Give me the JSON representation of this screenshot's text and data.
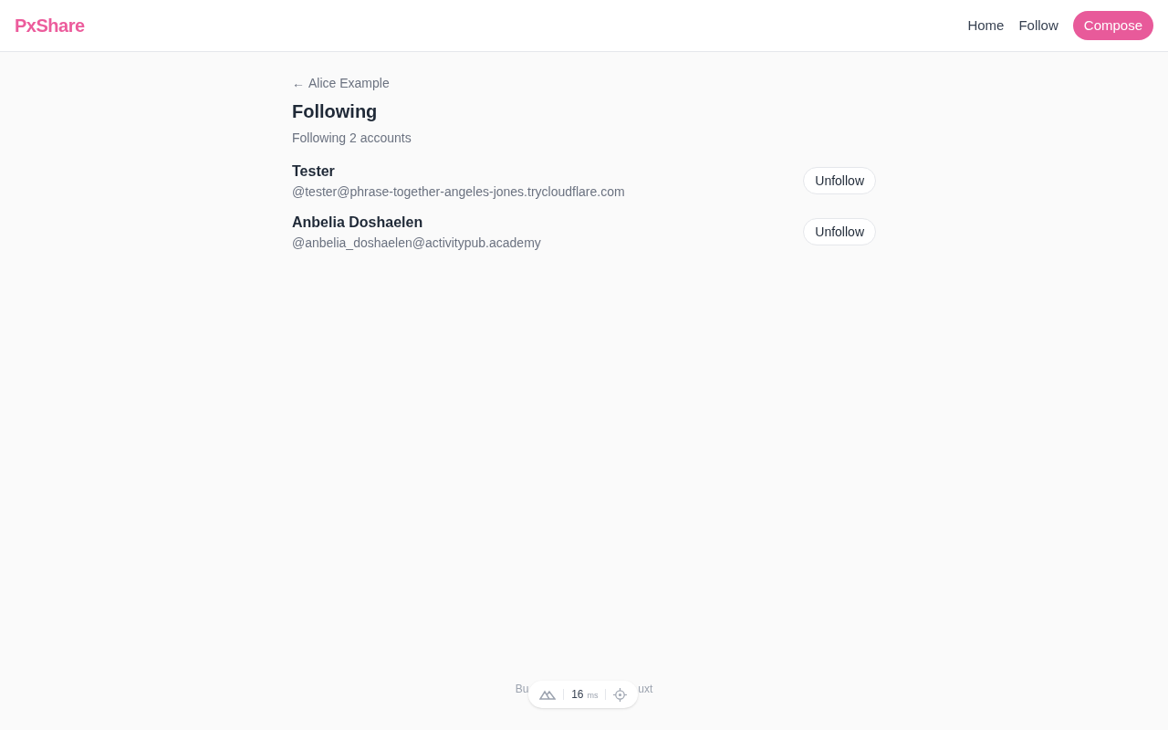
{
  "header": {
    "logo": "PxShare",
    "nav": [
      "Home",
      "Follow"
    ],
    "compose": "Compose"
  },
  "back": {
    "arrow": "←",
    "label": "Alice Example"
  },
  "title": "Following",
  "subtitle": "Following 2 accounts",
  "accounts": [
    {
      "name": "Tester",
      "handle": "@tester@phrase-together-angeles-jones.trycloudflare.com",
      "button": "Unfollow"
    },
    {
      "name": "Anbelia Doshaelen",
      "handle": "@anbelia_doshaelen@activitypub.academy",
      "button": "Unfollow"
    }
  ],
  "footer": {
    "left": "Bu",
    "right": "uxt"
  },
  "devtools": {
    "time": "16",
    "unit": "ms"
  }
}
